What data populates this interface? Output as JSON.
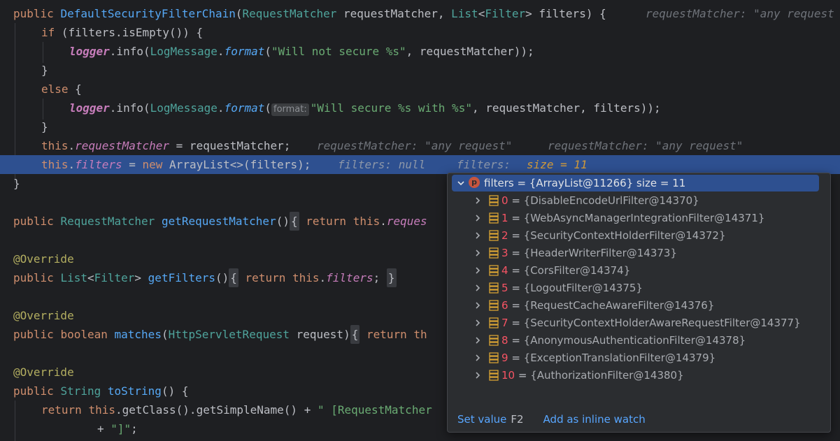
{
  "code": {
    "l1": {
      "kw": "public",
      "name": "DefaultSecurityFilterChain",
      "p1type": "RequestMatcher",
      "p1name": "requestMatcher",
      "p2type": "List",
      "p2generic": "Filter",
      "p2name": "filters",
      "brace": "{",
      "hint": "requestMatcher: \"any request"
    },
    "l2": {
      "kw": "if",
      "rest": " (filters.isEmpty()) {"
    },
    "l3": {
      "logger": "logger",
      "dot1": ".info(",
      "cls": "LogMessage",
      "dot2": ".",
      "fmt": "format",
      "open": "(",
      "str": "\"Will not secure %s\"",
      "rest": ", requestMatcher));"
    },
    "l4": {
      "text": "}"
    },
    "l5": {
      "kw": "else",
      "rest": " {"
    },
    "l6": {
      "logger": "logger",
      "dot1": ".info(",
      "cls": "LogMessage",
      "dot2": ".",
      "fmt": "format",
      "open": "(",
      "phint": "format:",
      "str": "\"Will secure %s with %s\"",
      "rest": ", requestMatcher, filters));"
    },
    "l7": {
      "text": "}"
    },
    "l8": {
      "kw": "this",
      "dot": ".",
      "field": "requestMatcher",
      "rest": " = requestMatcher;",
      "hint1": "requestMatcher: \"any request\"",
      "hint2": "requestMatcher: \"any request\""
    },
    "l9": {
      "kw": "this",
      "dot": ".",
      "field": "filters",
      "eq": " = ",
      "newkw": "new",
      "rest": " ArrayList<>(filters);",
      "hint1": "filters: null",
      "hint2": "filters:",
      "hint3": "size = 11"
    },
    "l10": {
      "text": "}"
    },
    "l12": {
      "kw": "public",
      "type": "RequestMatcher",
      "meth": "getRequestMatcher",
      "paren": "()",
      "fold_open": "{",
      "ret": "return",
      "this": "this",
      "dot": ".",
      "field": "reques"
    },
    "l14": {
      "ann": "@Override"
    },
    "l15": {
      "kw": "public",
      "type": "List",
      "generic": "Filter",
      "meth": "getFilters",
      "paren": "()",
      "fold_open": "{",
      "ret": "return",
      "this": "this",
      "dot": ".",
      "field": "filters",
      "semi": ";",
      "fold_close": "}"
    },
    "l17": {
      "ann": "@Override"
    },
    "l18": {
      "kw": "public",
      "kw2": "boolean",
      "meth": "matches",
      "open": "(",
      "type": "HttpServletRequest",
      "pname": "request",
      "close": ")",
      "fold_open": "{",
      "ret": "return",
      "this": "th"
    },
    "l20": {
      "ann": "@Override"
    },
    "l21": {
      "kw": "public",
      "type": "String",
      "meth": "toString",
      "rest": "() {"
    },
    "l22": {
      "ret": "return",
      "this": "this",
      "rest": ".getClass().getSimpleName() + ",
      "str": "\" [RequestMatcher"
    },
    "l23": {
      "plus": "+ ",
      "str": "\"]\"",
      "semi": ";"
    }
  },
  "popup": {
    "root": {
      "label": "filters = {ArrayList@11266}  size = 11",
      "badge": "p"
    },
    "items": [
      {
        "index": "0",
        "value": "{DisableEncodeUrlFilter@14370}"
      },
      {
        "index": "1",
        "value": "{WebAsyncManagerIntegrationFilter@14371}"
      },
      {
        "index": "2",
        "value": "{SecurityContextHolderFilter@14372}"
      },
      {
        "index": "3",
        "value": "{HeaderWriterFilter@14373}"
      },
      {
        "index": "4",
        "value": "{CorsFilter@14374}"
      },
      {
        "index": "5",
        "value": "{LogoutFilter@14375}"
      },
      {
        "index": "6",
        "value": "{RequestCacheAwareFilter@14376}"
      },
      {
        "index": "7",
        "value": "{SecurityContextHolderAwareRequestFilter@14377}"
      },
      {
        "index": "8",
        "value": "{AnonymousAuthenticationFilter@14378}"
      },
      {
        "index": "9",
        "value": "{ExceptionTranslationFilter@14379}"
      },
      {
        "index": "10",
        "value": "{AuthorizationFilter@14380}"
      }
    ],
    "footer": {
      "set_value": "Set value",
      "set_value_key": "F2",
      "add_watch": "Add as inline watch"
    }
  }
}
